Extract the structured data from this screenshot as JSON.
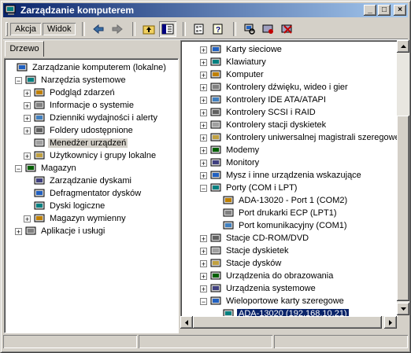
{
  "window": {
    "title": "Zarządzanie komputerem"
  },
  "titlebar_buttons": {
    "minimize": "_",
    "maximize": "□",
    "close": "×"
  },
  "menubar": {
    "action_label": "Akcja",
    "view_label": "Widok"
  },
  "toolbar": {
    "icons": [
      "back-arrow-icon",
      "forward-arrow-icon",
      "up-folder-icon",
      "show-hide-tree-icon",
      "properties-icon",
      "help-icon",
      "scan-hardware-icon",
      "disable-device-icon",
      "uninstall-device-icon"
    ]
  },
  "left_pane": {
    "tab_label": "Drzewo",
    "tree": [
      {
        "label": "Zarządzanie komputerem (lokalne)",
        "level": 0,
        "expander": "",
        "icon": "computer-management-icon"
      },
      {
        "label": "Narzędzia systemowe",
        "level": 1,
        "expander": "−",
        "icon": "system-tools-icon"
      },
      {
        "label": "Podgląd zdarzeń",
        "level": 2,
        "expander": "+",
        "icon": "event-viewer-icon"
      },
      {
        "label": "Informacje o systemie",
        "level": 2,
        "expander": "+",
        "icon": "system-info-icon"
      },
      {
        "label": "Dzienniki wydajności i alerty",
        "level": 2,
        "expander": "+",
        "icon": "performance-logs-icon"
      },
      {
        "label": "Foldery udostępnione",
        "level": 2,
        "expander": "+",
        "icon": "shared-folders-icon"
      },
      {
        "label": "Menedżer urządzeń",
        "level": 2,
        "expander": "",
        "icon": "device-manager-icon",
        "selected": true
      },
      {
        "label": "Użytkownicy i grupy lokalne",
        "level": 2,
        "expander": "+",
        "icon": "users-groups-icon"
      },
      {
        "label": "Magazyn",
        "level": 1,
        "expander": "−",
        "icon": "storage-icon"
      },
      {
        "label": "Zarządzanie dyskami",
        "level": 2,
        "expander": "",
        "icon": "disk-management-icon"
      },
      {
        "label": "Defragmentator dysków",
        "level": 2,
        "expander": "",
        "icon": "defragmenter-icon"
      },
      {
        "label": "Dyski logiczne",
        "level": 2,
        "expander": "",
        "icon": "logical-drives-icon"
      },
      {
        "label": "Magazyn wymienny",
        "level": 2,
        "expander": "+",
        "icon": "removable-storage-icon"
      },
      {
        "label": "Aplikacje i usługi",
        "level": 1,
        "expander": "+",
        "icon": "services-apps-icon"
      }
    ]
  },
  "right_pane": {
    "tree": [
      {
        "label": "Karty sieciowe",
        "level": 0,
        "expander": "+",
        "icon": "network-adapter-icon"
      },
      {
        "label": "Klawiatury",
        "level": 0,
        "expander": "+",
        "icon": "keyboard-icon"
      },
      {
        "label": "Komputer",
        "level": 0,
        "expander": "+",
        "icon": "computer-icon"
      },
      {
        "label": "Kontrolery dźwięku, wideo i gier",
        "level": 0,
        "expander": "+",
        "icon": "sound-icon"
      },
      {
        "label": "Kontrolery IDE ATA/ATAPI",
        "level": 0,
        "expander": "+",
        "icon": "ide-controller-icon"
      },
      {
        "label": "Kontrolery SCSI i RAID",
        "level": 0,
        "expander": "+",
        "icon": "scsi-controller-icon"
      },
      {
        "label": "Kontrolery stacji dyskietek",
        "level": 0,
        "expander": "+",
        "icon": "floppy-controller-icon"
      },
      {
        "label": "Kontrolery uniwersalnej magistrali szeregowe",
        "level": 0,
        "expander": "+",
        "icon": "usb-controller-icon"
      },
      {
        "label": "Modemy",
        "level": 0,
        "expander": "+",
        "icon": "modem-icon"
      },
      {
        "label": "Monitory",
        "level": 0,
        "expander": "+",
        "icon": "monitor-icon"
      },
      {
        "label": "Mysz i inne urządzenia wskazujące",
        "level": 0,
        "expander": "+",
        "icon": "mouse-icon"
      },
      {
        "label": "Porty (COM i LPT)",
        "level": 0,
        "expander": "−",
        "icon": "port-icon"
      },
      {
        "label": "ADA-13020 - Port 1 (COM2)",
        "level": 1,
        "expander": "",
        "icon": "port-icon"
      },
      {
        "label": "Port drukarki ECP (LPT1)",
        "level": 1,
        "expander": "",
        "icon": "port-icon"
      },
      {
        "label": "Port komunikacyjny (COM1)",
        "level": 1,
        "expander": "",
        "icon": "port-icon"
      },
      {
        "label": "Stacje CD-ROM/DVD",
        "level": 0,
        "expander": "+",
        "icon": "cdrom-icon"
      },
      {
        "label": "Stacje dyskietek",
        "level": 0,
        "expander": "+",
        "icon": "floppy-drive-icon"
      },
      {
        "label": "Stacje dysków",
        "level": 0,
        "expander": "+",
        "icon": "disk-drive-icon"
      },
      {
        "label": "Urządzenia do obrazowania",
        "level": 0,
        "expander": "+",
        "icon": "imaging-device-icon"
      },
      {
        "label": "Urządzenia systemowe",
        "level": 0,
        "expander": "+",
        "icon": "system-device-icon"
      },
      {
        "label": "Wieloportowe karty szeregowe",
        "level": 0,
        "expander": "−",
        "icon": "multiport-serial-icon"
      },
      {
        "label": "ADA-13020 (192.168.10.21)",
        "level": 1,
        "expander": "",
        "icon": "serial-adapter-icon",
        "selected": true
      }
    ]
  },
  "colors": {
    "title_start": "#0a246a",
    "title_end": "#a6caf0",
    "selection": "#0a246a",
    "face": "#d4d0c8"
  }
}
